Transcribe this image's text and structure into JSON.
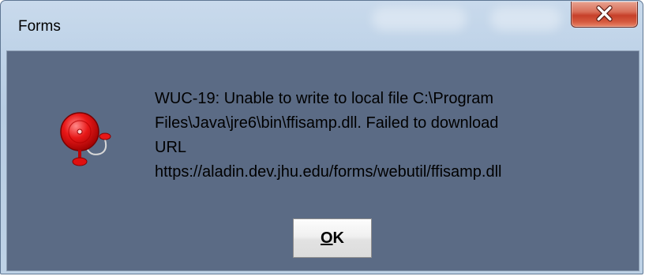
{
  "window": {
    "title": "Forms",
    "close_glyph": "x"
  },
  "dialog": {
    "icon": "alarm-bell-icon",
    "message_lines": [
      "WUC-19: Unable to write to local file C:\\Program",
      "Files\\Java\\jre6\\bin\\ffisamp.dll. Failed to download",
      "URL",
      "https://aladin.dev.jhu.edu/forms/webutil/ffisamp.dll"
    ],
    "ok_mnemonic": "O",
    "ok_rest": "K"
  },
  "colors": {
    "client_bg": "#5b6b85",
    "close_red": "#c7402a",
    "bell_red": "#e01010"
  }
}
